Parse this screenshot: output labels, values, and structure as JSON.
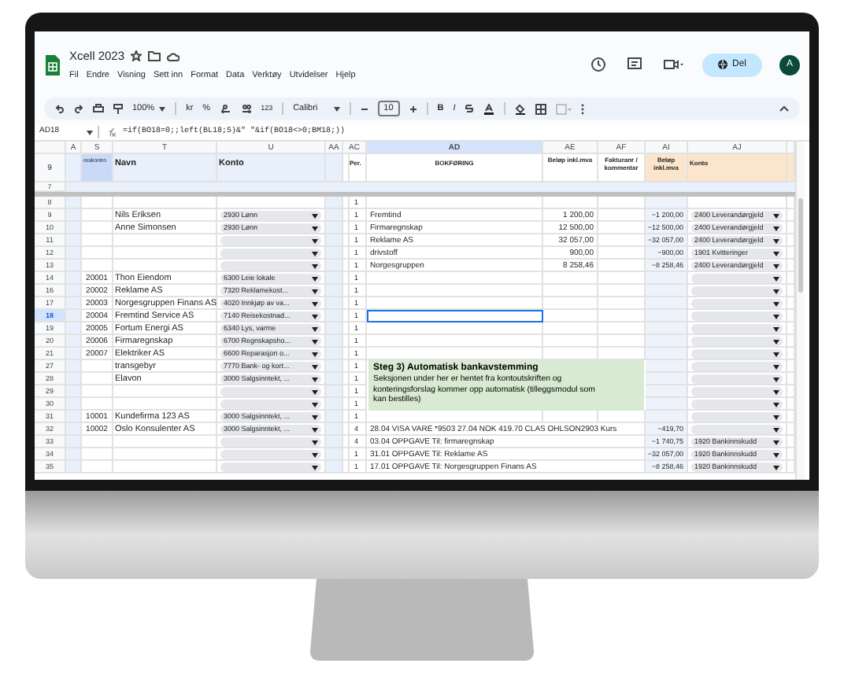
{
  "app": {
    "title": "Xcell 2023",
    "menus": [
      "Fil",
      "Endre",
      "Visning",
      "Sett inn",
      "Format",
      "Data",
      "Verktøy",
      "Utvidelser",
      "Hjelp"
    ],
    "share_button": "Del",
    "avatar": "A"
  },
  "toolbar": {
    "zoom": "100%",
    "currency": "kr",
    "percent": "%",
    "number_format": "123",
    "font": "Calibri",
    "font_size": "10",
    "bold": "B",
    "italic": "I"
  },
  "formula_bar": {
    "cell_ref": "AD18",
    "formula": "=if(BO18=0;;left(BL18;5)&\" \"&if(BO18<>0;BM18;))"
  },
  "columns": [
    {
      "label": "A",
      "selected": false
    },
    {
      "label": "S",
      "selected": false
    },
    {
      "label": "T",
      "selected": false
    },
    {
      "label": "U",
      "selected": false
    },
    {
      "label": "AA",
      "selected": false
    },
    {
      "label": "AC",
      "selected": false
    },
    {
      "label": "AD",
      "selected": true
    },
    {
      "label": "AE",
      "selected": false
    },
    {
      "label": "AF",
      "selected": false
    },
    {
      "label": "AI",
      "selected": false
    },
    {
      "label": "AJ",
      "selected": false
    }
  ],
  "header_row": {
    "number": "9",
    "reskontro": "reskontro",
    "navn": "Navn",
    "konto": "Konto",
    "per": "Per.",
    "bokforing": "BOKFØRING",
    "belop": "Beløp inkl.mva",
    "faktura": "Fakturanr / kommentar",
    "belop_bank": "Beløp inkl.mva",
    "konto_bank": "Konto"
  },
  "row_7": "7",
  "rows": [
    {
      "number": "8",
      "per": "1",
      "konto_dropdown": false,
      "konto_bank_dropdown": false,
      "selected": false
    },
    {
      "number": "9",
      "navn": "Nils Eriksen",
      "konto_dropdown": true,
      "konto": "2930 Lønn",
      "per": "1",
      "bokforing": "Fremtind",
      "belop": "1 200,00",
      "belop_bank": "−1 200,00",
      "konto_bank_dropdown": true,
      "konto_bank": "2400 Leverandørgjeld",
      "selected": false
    },
    {
      "number": "10",
      "navn": "Anne Simonsen",
      "konto_dropdown": true,
      "konto": "2930 Lønn",
      "per": "1",
      "bokforing": "Firmaregnskap",
      "belop": "12 500,00",
      "belop_bank": "−12 500,00",
      "konto_bank_dropdown": true,
      "konto_bank": "2400 Leverandørgjeld",
      "selected": false
    },
    {
      "number": "11",
      "konto_dropdown": true,
      "per": "1",
      "bokforing": "Reklame AS",
      "belop": "32 057,00",
      "belop_bank": "−32 057,00",
      "konto_bank_dropdown": true,
      "konto_bank": "2400 Leverandørgjeld",
      "selected": false
    },
    {
      "number": "12",
      "konto_dropdown": true,
      "per": "1",
      "bokforing": "drivstoff",
      "belop": "900,00",
      "belop_bank": "−900,00",
      "konto_bank_dropdown": true,
      "konto_bank": "1901 Kvitteringer",
      "selected": false
    },
    {
      "number": "13",
      "konto_dropdown": true,
      "per": "1",
      "bokforing": "Norgesgruppen",
      "belop": "8 258,46",
      "belop_bank": "−8 258,46",
      "konto_bank_dropdown": true,
      "konto_bank": "2400 Leverandørgjeld",
      "selected": false
    },
    {
      "number": "14",
      "reskontro": "20001",
      "navn": "Thon Eiendom",
      "konto_dropdown": true,
      "konto": "6300 Leie lokale",
      "per": "1",
      "konto_bank_dropdown": true,
      "selected": false
    },
    {
      "number": "16",
      "reskontro": "20002",
      "navn": "Reklame AS",
      "konto_dropdown": true,
      "konto": "7320 Reklamekost...",
      "per": "1",
      "konto_bank_dropdown": true,
      "selected": false
    },
    {
      "number": "17",
      "reskontro": "20003",
      "navn": "Norgesgruppen Finans AS",
      "konto_dropdown": true,
      "konto": "4020 Innkjøp av va...",
      "per": "1",
      "konto_bank_dropdown": true,
      "selected": false
    },
    {
      "number": "18",
      "reskontro": "20004",
      "navn": "Fremtind Service AS",
      "konto_dropdown": true,
      "konto": "7140 Reisekostnad...",
      "per": "1",
      "konto_bank_dropdown": true,
      "selected": true
    },
    {
      "number": "19",
      "reskontro": "20005",
      "navn": "Fortum Energi AS",
      "konto_dropdown": true,
      "konto": "6340 Lys, varme",
      "per": "1",
      "konto_bank_dropdown": true,
      "selected": false
    },
    {
      "number": "20",
      "reskontro": "20006",
      "navn": "Firmaregnskap",
      "konto_dropdown": true,
      "konto": "6700 Regnskapsho...",
      "per": "1",
      "konto_bank_dropdown": true,
      "selected": false
    },
    {
      "number": "21",
      "reskontro": "20007",
      "navn": "Elektriker AS",
      "konto_dropdown": true,
      "konto": "6600 Reparasjon o...",
      "per": "1",
      "konto_bank_dropdown": true,
      "selected": false
    },
    {
      "number": "27",
      "navn": "transgebyr",
      "konto_dropdown": true,
      "konto": "7770 Bank- og kort...",
      "per": "1",
      "konto_bank_dropdown": true,
      "selected": false,
      "note": {
        "title": "Steg 3) Automatisk bankavstemming",
        "text": "Seksjonen under her er hentet fra kontoutskriften og konteringsforslag kommer opp automatisk (tilleggsmodul som kan bestilles)"
      }
    },
    {
      "number": "28",
      "navn": "Elavon",
      "konto_dropdown": true,
      "konto": "3000 Salgsinntekt, ...",
      "per": "1",
      "konto_bank_dropdown": true,
      "selected": false
    },
    {
      "number": "29",
      "konto_dropdown": true,
      "per": "1",
      "konto_bank_dropdown": true,
      "selected": false
    },
    {
      "number": "30",
      "konto_dropdown": true,
      "per": "1",
      "konto_bank_dropdown": true,
      "selected": false
    },
    {
      "number": "31",
      "reskontro": "10001",
      "navn": "Kundefirma 123 AS",
      "konto_dropdown": true,
      "konto": "3000 Salgsinntekt, ...",
      "per": "1",
      "konto_bank_dropdown": true,
      "selected": false
    },
    {
      "number": "32",
      "reskontro": "10002",
      "navn": "Oslo Konsulenter AS",
      "konto_dropdown": true,
      "konto": "3000 Salgsinntekt, ...",
      "per": "4",
      "bokforing": "28.04 VISA VARE *9503 27.04 NOK 419.70 CLAS OHLSON2903 Kurs",
      "belop_bank": "−419,70",
      "konto_bank_dropdown": true,
      "selected": false
    },
    {
      "number": "33",
      "konto_dropdown": true,
      "per": "4",
      "bokforing": "03.04 OPPGAVE Til: firmaregnskap",
      "belop_bank": "−1 740,75",
      "konto_bank_dropdown": true,
      "konto_bank": "1920 Bankinnskudd",
      "selected": false
    },
    {
      "number": "34",
      "konto_dropdown": true,
      "per": "1",
      "bokforing": "31.01 OPPGAVE Til: Reklame AS",
      "belop_bank": "−32 057,00",
      "konto_bank_dropdown": true,
      "konto_bank": "1920 Bankinnskudd",
      "selected": false
    },
    {
      "number": "35",
      "konto_dropdown": true,
      "per": "1",
      "bokforing": "17.01 OPPGAVE Til: Norgesgruppen Finans AS",
      "belop_bank": "−8 258,46",
      "konto_bank_dropdown": true,
      "konto_bank": "1920 Bankinnskudd",
      "selected": false
    }
  ]
}
